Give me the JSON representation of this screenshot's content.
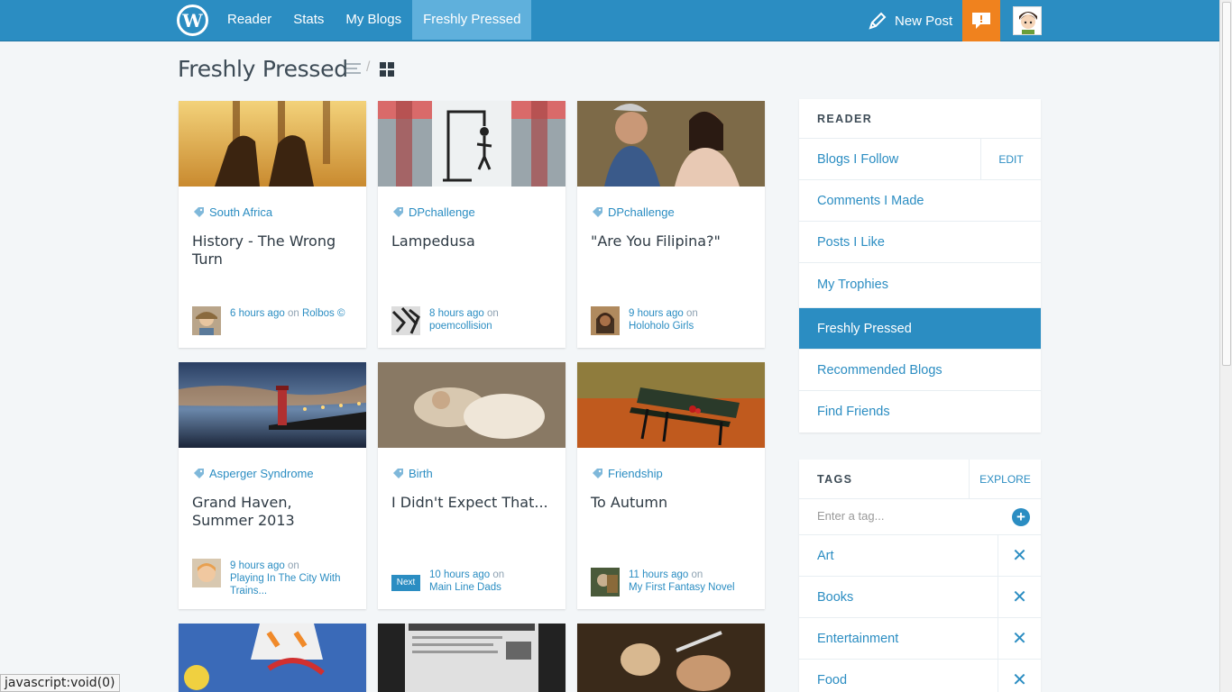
{
  "topbar": {
    "logo_text": "W",
    "nav": [
      "Reader",
      "Stats",
      "My Blogs",
      "Freshly Pressed"
    ],
    "active_nav": "Freshly Pressed",
    "new_post": "New Post",
    "colors": {
      "bar": "#2b8dc2",
      "active": "#5fb0dc",
      "notifications": "#f0821e"
    },
    "icons": [
      "wordpress-logo-icon",
      "pencil-icon",
      "speech-bubble-icon",
      "user-avatar"
    ]
  },
  "page": {
    "title": "Freshly Pressed"
  },
  "cards": [
    {
      "tag": "South Africa",
      "title": "History - The Wrong Turn",
      "time": "6 hours ago",
      "on": "on",
      "blog": "Rolbos ©"
    },
    {
      "tag": "DPchallenge",
      "title": "Lampedusa",
      "time": "8 hours ago",
      "on": "on",
      "blog": "poemcollision"
    },
    {
      "tag": "DPchallenge",
      "title": "\"Are You Filipina?\"",
      "time": "9 hours ago",
      "on": "on",
      "blog": "Holoholo Girls"
    },
    {
      "tag": "Asperger Syndrome",
      "title": "Grand Haven, Summer 2013",
      "time": "9 hours ago",
      "on": "on",
      "blog": "Playing In The City With Trains..."
    },
    {
      "tag": "Birth",
      "title": "I Didn't Expect That...",
      "time": "10 hours ago",
      "on": "on",
      "blog": "Main Line Dads",
      "badge": "Next"
    },
    {
      "tag": "Friendship",
      "title": "To Autumn",
      "time": "11 hours ago",
      "on": "on",
      "blog": "My First Fantasy Novel"
    }
  ],
  "reader": {
    "heading": "READER",
    "edit": "EDIT",
    "items": [
      "Blogs I Follow",
      "Comments I Made",
      "Posts I Like",
      "My Trophies",
      "Freshly Pressed",
      "Recommended Blogs",
      "Find Friends"
    ]
  },
  "tags": {
    "heading": "TAGS",
    "explore": "EXPLORE",
    "placeholder": "Enter a tag...",
    "items": [
      "Art",
      "Books",
      "Entertainment",
      "Food"
    ]
  },
  "status_bar": "javascript:void(0)"
}
